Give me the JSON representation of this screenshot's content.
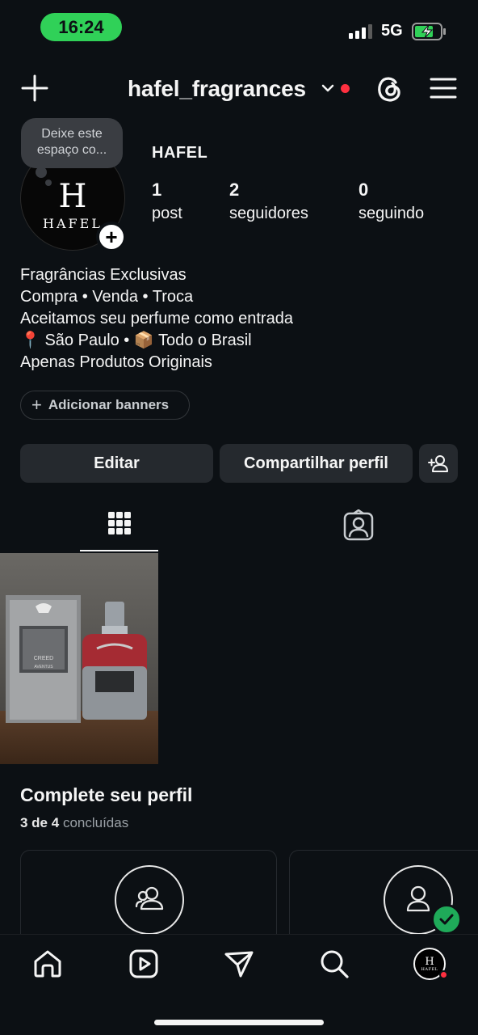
{
  "status_bar": {
    "time": "16:24",
    "network": "5G"
  },
  "header": {
    "username": "hafel_fragrances"
  },
  "note": {
    "text": "Deixe este espaço co..."
  },
  "avatar": {
    "monogram": "H",
    "brand": "HAFEL"
  },
  "profile": {
    "display_name": "HAFEL",
    "stats": [
      {
        "value": "1",
        "label": "post"
      },
      {
        "value": "2",
        "label": "seguidores"
      },
      {
        "value": "0",
        "label": "seguindo"
      }
    ],
    "bio": [
      "Fragrâncias Exclusivas",
      "Compra • Venda • Troca",
      "Aceitamos seu perfume como entrada",
      "📍 São Paulo • 📦 Todo o Brasil",
      "Apenas Produtos Originais"
    ]
  },
  "buttons": {
    "add_banners": "Adicionar banners",
    "edit": "Editar",
    "share": "Compartilhar perfil"
  },
  "post": {
    "box_brand": "CREED",
    "box_name": "AVENTUS"
  },
  "complete_profile": {
    "title": "Complete seu perfil",
    "progress_bold": "3 de 4",
    "progress_rest": "concluídas",
    "completed": 3,
    "total": 4
  },
  "colors": {
    "background": "#0c1014",
    "button": "#25292e",
    "accent_red": "#ff3040",
    "time_pill": "#30d158",
    "check_green": "#1faa59"
  }
}
